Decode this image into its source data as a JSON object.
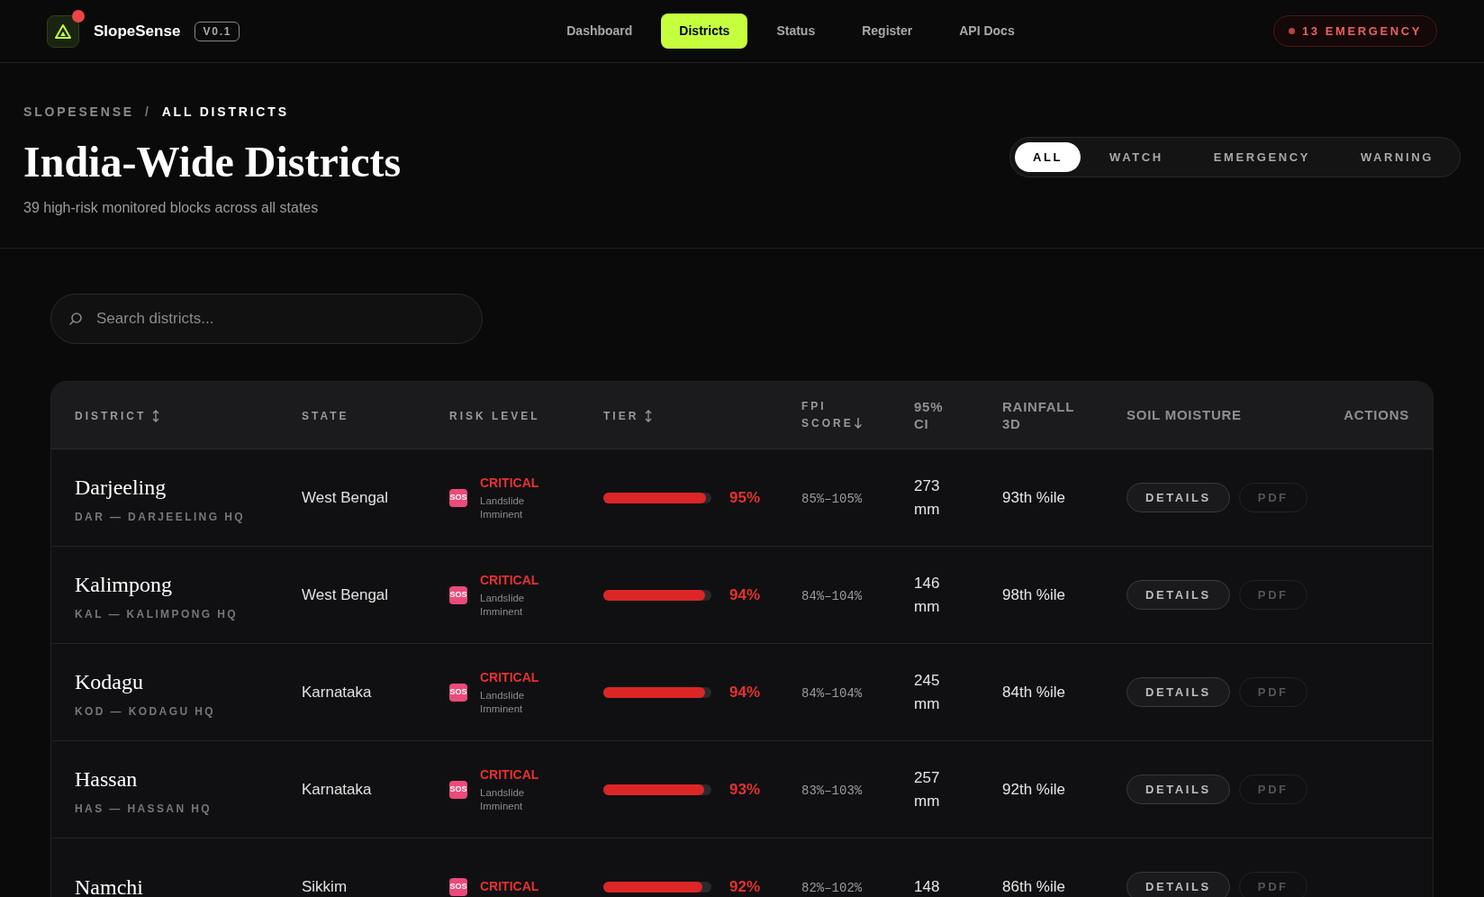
{
  "brand": {
    "name": "SlopeSense",
    "version": "V0.1",
    "notification": true
  },
  "nav": [
    {
      "label": "Dashboard",
      "selected": false
    },
    {
      "label": "Districts",
      "selected": true
    },
    {
      "label": "Status",
      "selected": false
    },
    {
      "label": "Register",
      "selected": false
    },
    {
      "label": "API Docs",
      "selected": false
    }
  ],
  "alert": {
    "label": "13 EMERGENCY"
  },
  "breadcrumb": [
    {
      "label": "SLOPESENSE",
      "current": false
    },
    {
      "label": "ALL DISTRICTS",
      "current": true
    }
  ],
  "breadcrumb_separator": "/",
  "title": "India-Wide Districts",
  "subtitle": "39 high-risk monitored blocks across all states",
  "filters": [
    {
      "label": "ALL",
      "selected": true
    },
    {
      "label": "WATCH",
      "selected": false
    },
    {
      "label": "EMERGENCY",
      "selected": false
    },
    {
      "label": "WARNING",
      "selected": false
    }
  ],
  "search": {
    "placeholder": "Search districts..."
  },
  "table": {
    "columns": [
      {
        "label": "DISTRICT",
        "sortable": true
      },
      {
        "label": "STATE"
      },
      {
        "label": "RISK LEVEL"
      },
      {
        "label": "TIER",
        "sortable": true
      },
      {
        "label": "FPI SCORE",
        "sorted_desc": true
      },
      {
        "label": "95% CI"
      },
      {
        "label": "RAINFALL 3D"
      },
      {
        "label": "SOIL MOISTURE"
      },
      {
        "label": "ACTIONS"
      }
    ],
    "rows": [
      {
        "district": "Darjeeling",
        "code": "DAR — DARJEELING HQ",
        "state": "West Bengal",
        "badge": "SOS",
        "risk": "CRITICAL",
        "risk_note": "Landslide Imminent",
        "level": 0.95,
        "tier": "95%",
        "fpi_range": "85%–105%",
        "rainfall": "273 mm",
        "percentile": "93th %ile",
        "buttons": [
          {
            "label": "DETAILS",
            "disabled": false
          },
          {
            "label": "PDF",
            "disabled": true
          }
        ]
      },
      {
        "district": "Kalimpong",
        "code": "KAL — KALIMPONG HQ",
        "state": "West Bengal",
        "badge": "SOS",
        "risk": "CRITICAL",
        "risk_note": "Landslide Imminent",
        "level": 0.94,
        "tier": "94%",
        "fpi_range": "84%–104%",
        "rainfall": "146 mm",
        "percentile": "98th %ile",
        "buttons": [
          {
            "label": "DETAILS",
            "disabled": false
          },
          {
            "label": "PDF",
            "disabled": true
          }
        ]
      },
      {
        "district": "Kodagu",
        "code": "KOD — KODAGU HQ",
        "state": "Karnataka",
        "badge": "SOS",
        "risk": "CRITICAL",
        "risk_note": "Landslide Imminent",
        "level": 0.94,
        "tier": "94%",
        "fpi_range": "84%–104%",
        "rainfall": "245 mm",
        "percentile": "84th %ile",
        "buttons": [
          {
            "label": "DETAILS",
            "disabled": false
          },
          {
            "label": "PDF",
            "disabled": true
          }
        ]
      },
      {
        "district": "Hassan",
        "code": "HAS — HASSAN HQ",
        "state": "Karnataka",
        "badge": "SOS",
        "risk": "CRITICAL",
        "risk_note": "Landslide Imminent",
        "level": 0.93,
        "tier": "93%",
        "fpi_range": "83%–103%",
        "rainfall": "257 mm",
        "percentile": "92th %ile",
        "buttons": [
          {
            "label": "DETAILS",
            "disabled": false
          },
          {
            "label": "PDF",
            "disabled": true
          }
        ]
      },
      {
        "district": "Namchi",
        "state": "Sikkim",
        "badge": "SOS",
        "risk": "CRITICAL",
        "level": 0.92,
        "tier": "92%",
        "fpi_range": "82%–102%",
        "rainfall": "148",
        "percentile": "86th %ile",
        "buttons": [
          {
            "label": "DETAILS",
            "disabled": false
          },
          {
            "label": "PDF",
            "disabled": true
          }
        ]
      }
    ]
  }
}
